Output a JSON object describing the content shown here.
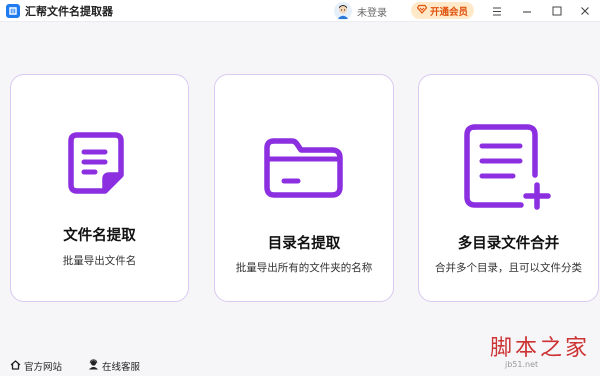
{
  "window": {
    "title": "汇帮文件名提取器",
    "user_label": "未登录",
    "vip_label": "开通会员",
    "controls": [
      "menu-icon",
      "minimize-icon",
      "maximize-icon",
      "close-icon"
    ]
  },
  "colors": {
    "accent": "#8b2fe0",
    "card_border": "#dcc9f2",
    "vip_bg": "#ffe9c8",
    "vip_text": "#e0530f",
    "background": "#f6f6f8"
  },
  "cards": [
    {
      "title": "文件名提取",
      "desc": "批量导出文件名",
      "icon": "document-icon"
    },
    {
      "title": "目录名提取",
      "desc": "批量导出所有的文件夹的名称",
      "icon": "folder-icon"
    },
    {
      "title": "多目录文件合并",
      "desc": "合并多个目录，且可以文件分类",
      "icon": "list-add-icon"
    }
  ],
  "footer": {
    "website": "官方网站",
    "support": "在线客服"
  },
  "watermark": {
    "text": "脚本之家",
    "sub": "jb51.net"
  }
}
